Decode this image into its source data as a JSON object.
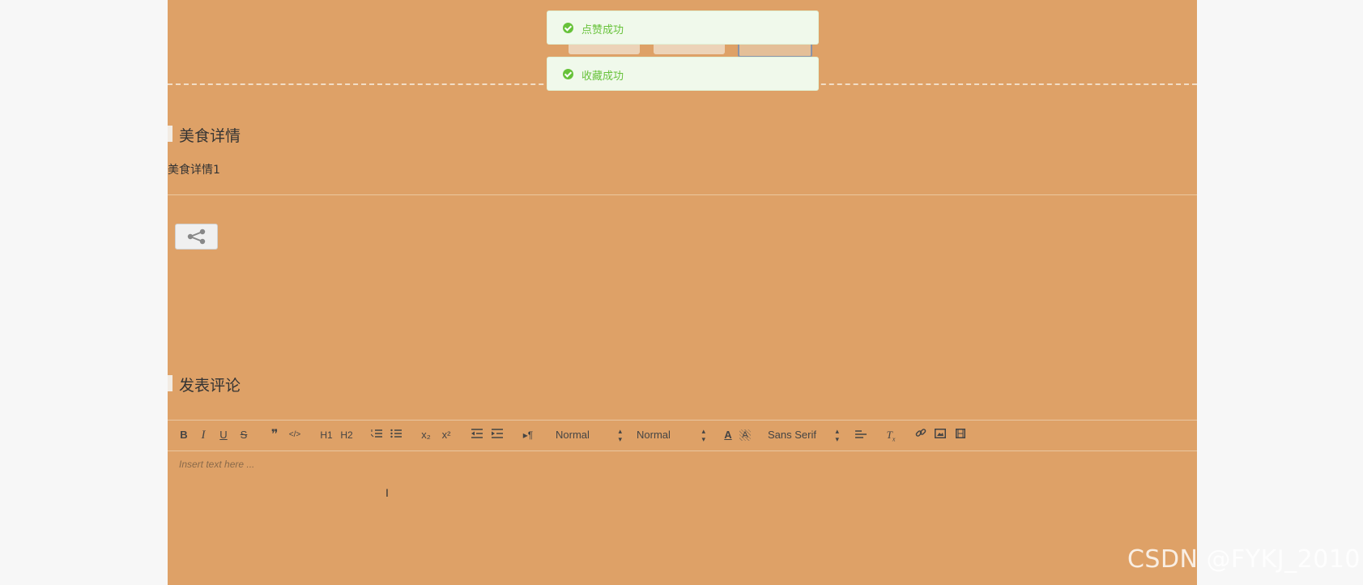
{
  "toasts": [
    {
      "text": "点赞成功",
      "type": "success"
    },
    {
      "text": "收藏成功",
      "type": "success"
    }
  ],
  "detail": {
    "title": "美食详情",
    "content": "美食详情1"
  },
  "comment": {
    "title": "发表评论",
    "placeholder": "Insert text here ..."
  },
  "toolbar": {
    "header_select": "Normal",
    "size_select": "Normal",
    "font_select": "Sans Serif",
    "bold": "B",
    "italic": "I",
    "underline": "U",
    "strike": "S",
    "blockquote": "❞",
    "code": "</>",
    "h1": "H1",
    "h2": "H2",
    "sub": "x₂",
    "sup": "x²"
  },
  "share": {
    "icon": "share-icon"
  },
  "watermark": "CSDN @FYKJ_2010",
  "colors": {
    "background": "#dea167",
    "page": "#f7f7f7",
    "success": "#67c23a",
    "toast_bg": "#f0f9eb"
  }
}
